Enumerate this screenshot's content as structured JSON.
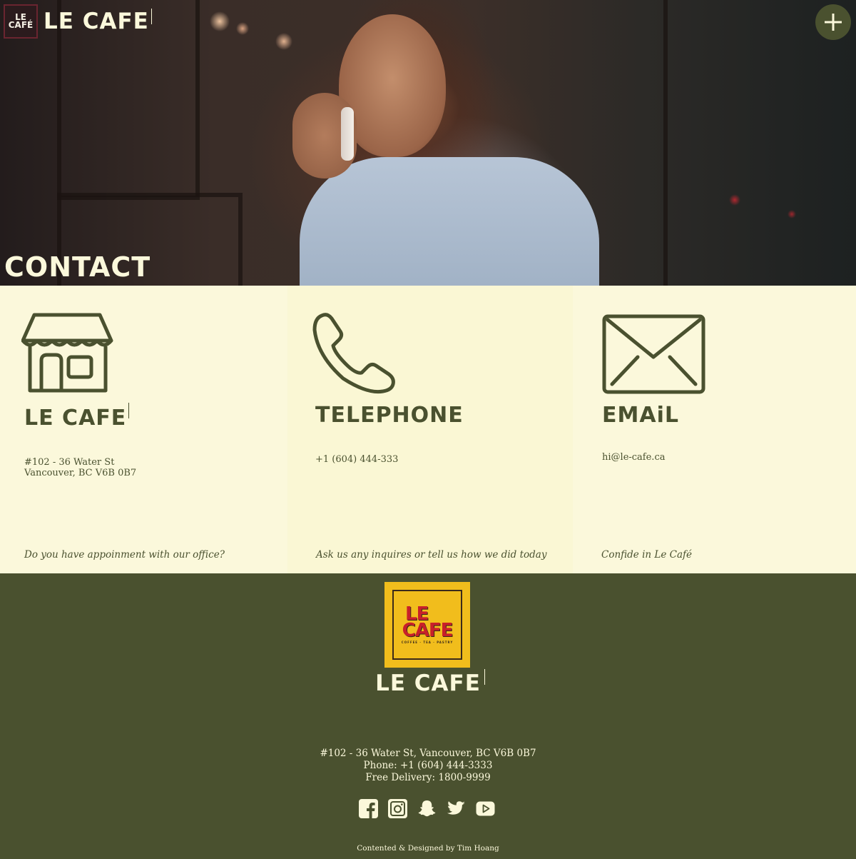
{
  "header": {
    "logo_line1": "LE",
    "logo_line2": "CAFÉ",
    "brand_name": "LE CAFE",
    "menu_button_icon": "plus-icon"
  },
  "hero": {
    "title": "CONTACT"
  },
  "contact": {
    "location": {
      "icon": "storefront-icon",
      "heading": "LE CAFE",
      "address_line1": "#102 - 36 Water St",
      "address_line2": "Vancouver, BC V6B 0B7",
      "note": "Do you have appoinment with our office?"
    },
    "telephone": {
      "icon": "phone-icon",
      "heading": "TELEPHONE",
      "number": "+1 (604) 444-333",
      "note": "Ask us any inquires or tell us how we did today"
    },
    "email": {
      "icon": "envelope-icon",
      "heading": "EMAiL",
      "address": "hi@le-cafe.ca",
      "note": "Confide in Le Café"
    }
  },
  "footer": {
    "logo_le": "LE",
    "logo_cafe": "CAFE",
    "logo_tagline": "COFFEE · TEA · PASTRY",
    "brand_name": "LE CAFE",
    "address": "#102 - 36 Water St, Vancouver, BC V6B 0B7",
    "phone": "Phone: +1 (604) 444-3333",
    "delivery": "Free Delivery: 1800-9999",
    "socials": [
      "facebook-icon",
      "instagram-icon",
      "snapchat-icon",
      "twitter-icon",
      "youtube-icon"
    ],
    "credit": "Contented & Designed by Tim Hoang"
  },
  "colors": {
    "olive": "#4a512f",
    "cream": "#fbf8db",
    "logo_yellow": "#f1bd1c",
    "logo_red": "#c8202a"
  }
}
